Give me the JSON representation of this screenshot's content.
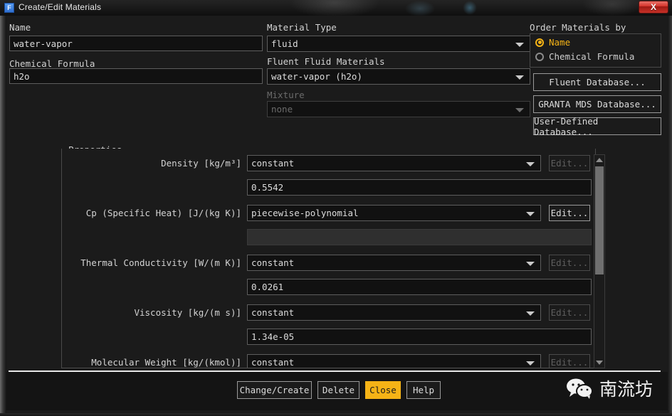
{
  "window": {
    "title": "Create/Edit Materials",
    "icon": "fluent-f-icon",
    "icon_letter": "F",
    "close_label": "X"
  },
  "left_form": {
    "name_label": "Name",
    "name_value": "water-vapor",
    "formula_label": "Chemical Formula",
    "formula_value": "h2o"
  },
  "middle_form": {
    "material_type_label": "Material Type",
    "material_type_value": "fluid",
    "fluent_materials_label": "Fluent Fluid Materials",
    "fluent_materials_value": "water-vapor (h2o)",
    "mixture_label": "Mixture",
    "mixture_value": "none"
  },
  "order_by": {
    "title": "Order Materials by",
    "options": [
      {
        "label": "Name",
        "selected": true
      },
      {
        "label": "Chemical Formula",
        "selected": false
      }
    ]
  },
  "database_buttons": [
    "Fluent Database...",
    "GRANTA MDS Database...",
    "User-Defined Database..."
  ],
  "properties": {
    "title": "Properties",
    "edit_label": "Edit...",
    "rows": [
      {
        "name": "Density [kg/m³]",
        "method": "constant",
        "edit_enabled": false,
        "value": "0.5542",
        "value_disabled": false
      },
      {
        "name": "Cp (Specific Heat) [J/(kg K)]",
        "method": "piecewise-polynomial",
        "edit_enabled": true,
        "value": "",
        "value_disabled": true
      },
      {
        "name": "Thermal Conductivity [W/(m K)]",
        "method": "constant",
        "edit_enabled": false,
        "value": "0.0261",
        "value_disabled": false
      },
      {
        "name": "Viscosity [kg/(m s)]",
        "method": "constant",
        "edit_enabled": false,
        "value": "1.34e-05",
        "value_disabled": false
      },
      {
        "name": "Molecular Weight [kg/(kmol)]",
        "method": "constant",
        "edit_enabled": false,
        "value": "",
        "value_disabled": false
      }
    ]
  },
  "footer": {
    "change_create": "Change/Create",
    "delete": "Delete",
    "close": "Close",
    "help": "Help"
  },
  "watermark": {
    "icon": "wechat-icon",
    "text": "南流坊"
  },
  "colors": {
    "accent": "#f5b316",
    "dialog_bg": "#1b1b1b",
    "field_bg": "#111111",
    "border": "#5d5d5d",
    "close_button": "#c73127"
  }
}
